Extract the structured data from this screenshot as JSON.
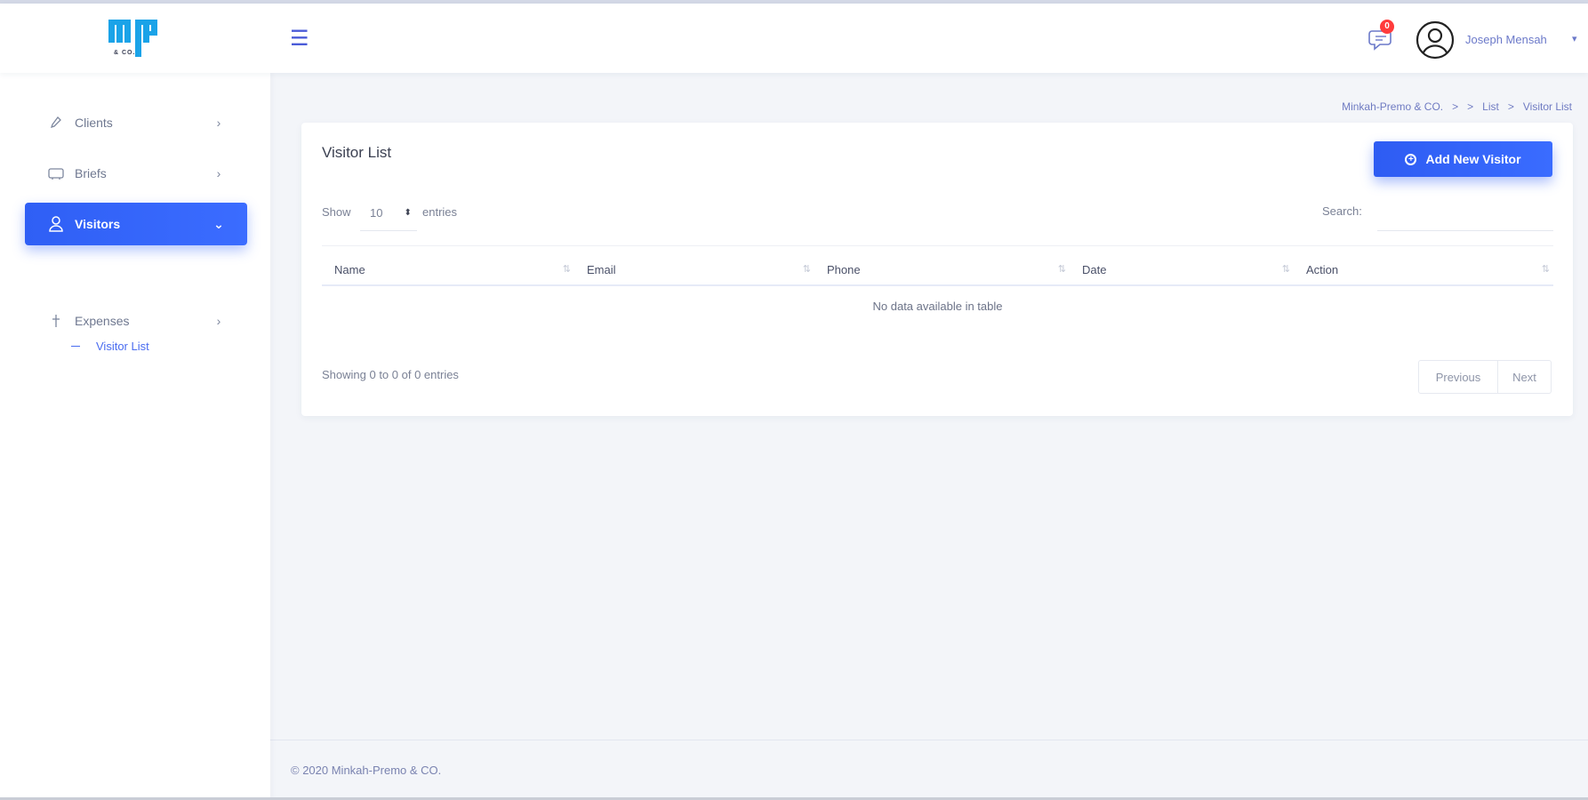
{
  "app": {
    "logo_text": "& CO."
  },
  "header": {
    "notification_count": "0",
    "user_name": "Joseph Mensah",
    "user_caret": "▾"
  },
  "sidebar": {
    "items": [
      {
        "label": "Clients",
        "icon": "clients-icon",
        "chevron": "›"
      },
      {
        "label": "Briefs",
        "icon": "briefs-icon",
        "chevron": "›"
      },
      {
        "label": "Visitors",
        "icon": "user-icon",
        "chevron": "⌄",
        "active": true
      },
      {
        "label": "Expenses",
        "icon": "expenses-icon",
        "chevron": "›"
      }
    ],
    "subitems": [
      {
        "label": "Visitor List"
      }
    ]
  },
  "breadcrumb": {
    "items": [
      "Minkah-Premo & CO.",
      "List",
      "Visitor List"
    ],
    "separator": ">"
  },
  "card": {
    "title": "Visitor List",
    "add_button_label": "Add New Visitor",
    "show_label": "Show",
    "length_value": "10",
    "entries_label": "entries",
    "search_label": "Search:",
    "search_value": "",
    "columns": [
      "Name",
      "Email",
      "Phone",
      "Date",
      "Action"
    ],
    "empty_message": "No data available in table",
    "info": "Showing 0 to 0 of 0 entries",
    "prev_label": "Previous",
    "next_label": "Next"
  },
  "footer": {
    "text": "© 2020 Minkah-Premo & CO."
  },
  "colors": {
    "accent": "#2f5ff5",
    "badge": "#ff3b3b",
    "logo": "#1aa3e8"
  }
}
